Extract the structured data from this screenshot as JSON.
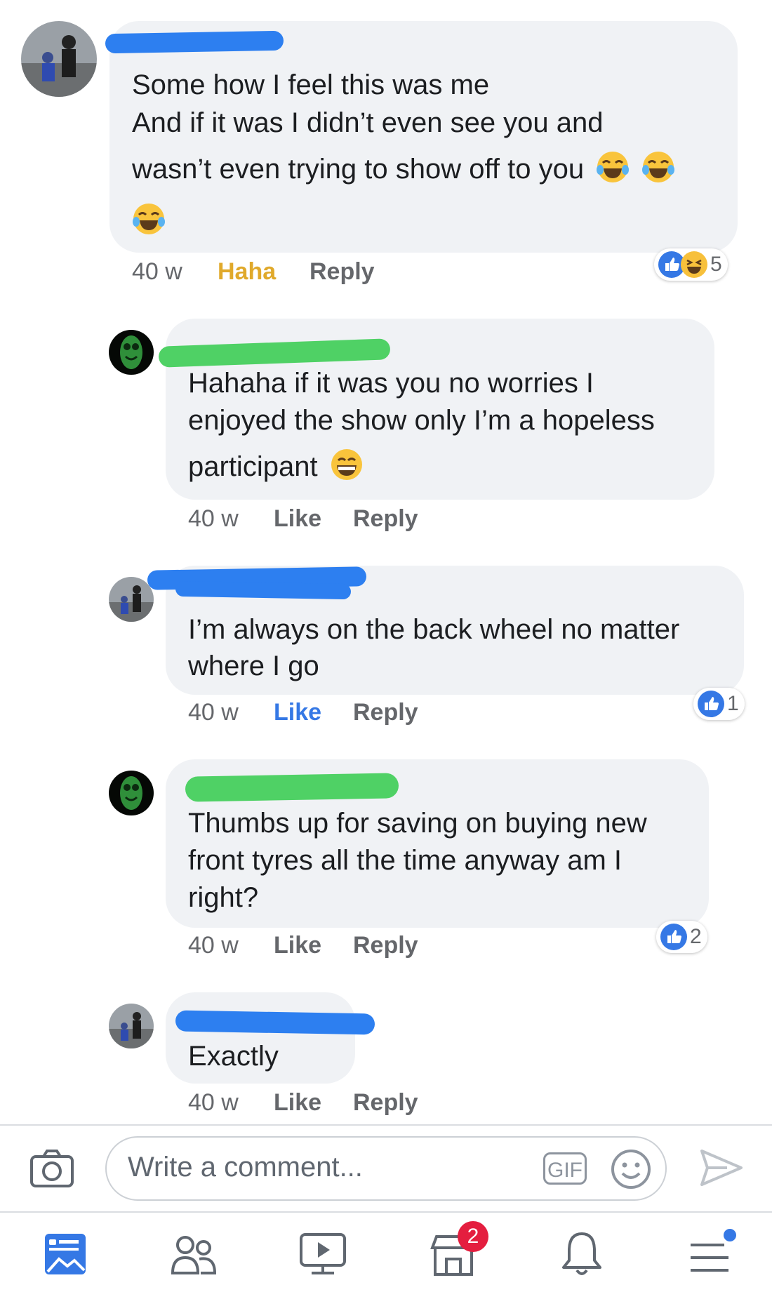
{
  "comments": [
    {
      "avatar": "user-photo-avatar",
      "text_lines": [
        "Some how I feel this was me",
        "And if it was I didn’t even see you and",
        "wasn’t even trying to show off to you"
      ],
      "emoji": "laughing-tears-emoji",
      "time": "40 w",
      "action_react": "Haha",
      "action_reply": "Reply",
      "reaction_count": "5"
    },
    {
      "avatar": "green-tiki-avatar",
      "text_lines": [
        "Hahaha if it was you no worries I",
        "enjoyed the show only I’m a hopeless",
        "participant"
      ],
      "emoji": "grinning-emoji",
      "time": "40 w",
      "action_react": "Like",
      "action_reply": "Reply"
    },
    {
      "avatar": "user-photo-avatar",
      "text_lines": [
        "I’m always on the back wheel no matter",
        "where I go"
      ],
      "time": "40 w",
      "action_react": "Like",
      "action_reply": "Reply",
      "reaction_count": "1"
    },
    {
      "avatar": "green-tiki-avatar",
      "text_lines": [
        "Thumbs up for saving on buying new",
        "front tyres all the time anyway am I",
        "right?"
      ],
      "time": "40 w",
      "action_react": "Like",
      "action_reply": "Reply",
      "reaction_count": "2"
    },
    {
      "avatar": "user-photo-avatar",
      "text_lines": [
        "Exactly"
      ],
      "time": "40 w",
      "action_react": "Like",
      "action_reply": "Reply"
    }
  ],
  "composer": {
    "placeholder": "Write a comment...",
    "gif_label": "GIF"
  },
  "bottom_nav": {
    "items": [
      "news-feed-icon",
      "friends-icon",
      "watch-icon",
      "marketplace-icon",
      "notifications-icon",
      "menu-icon"
    ],
    "marketplace_badge": "2"
  },
  "colors": {
    "like_blue": "#3578e5",
    "haha_yellow": "#e0a92b",
    "bubble_gray": "#f0f2f5",
    "redact_blue": "#2d7ff0",
    "redact_green": "#4fd165",
    "badge_red": "#e41e3f"
  }
}
